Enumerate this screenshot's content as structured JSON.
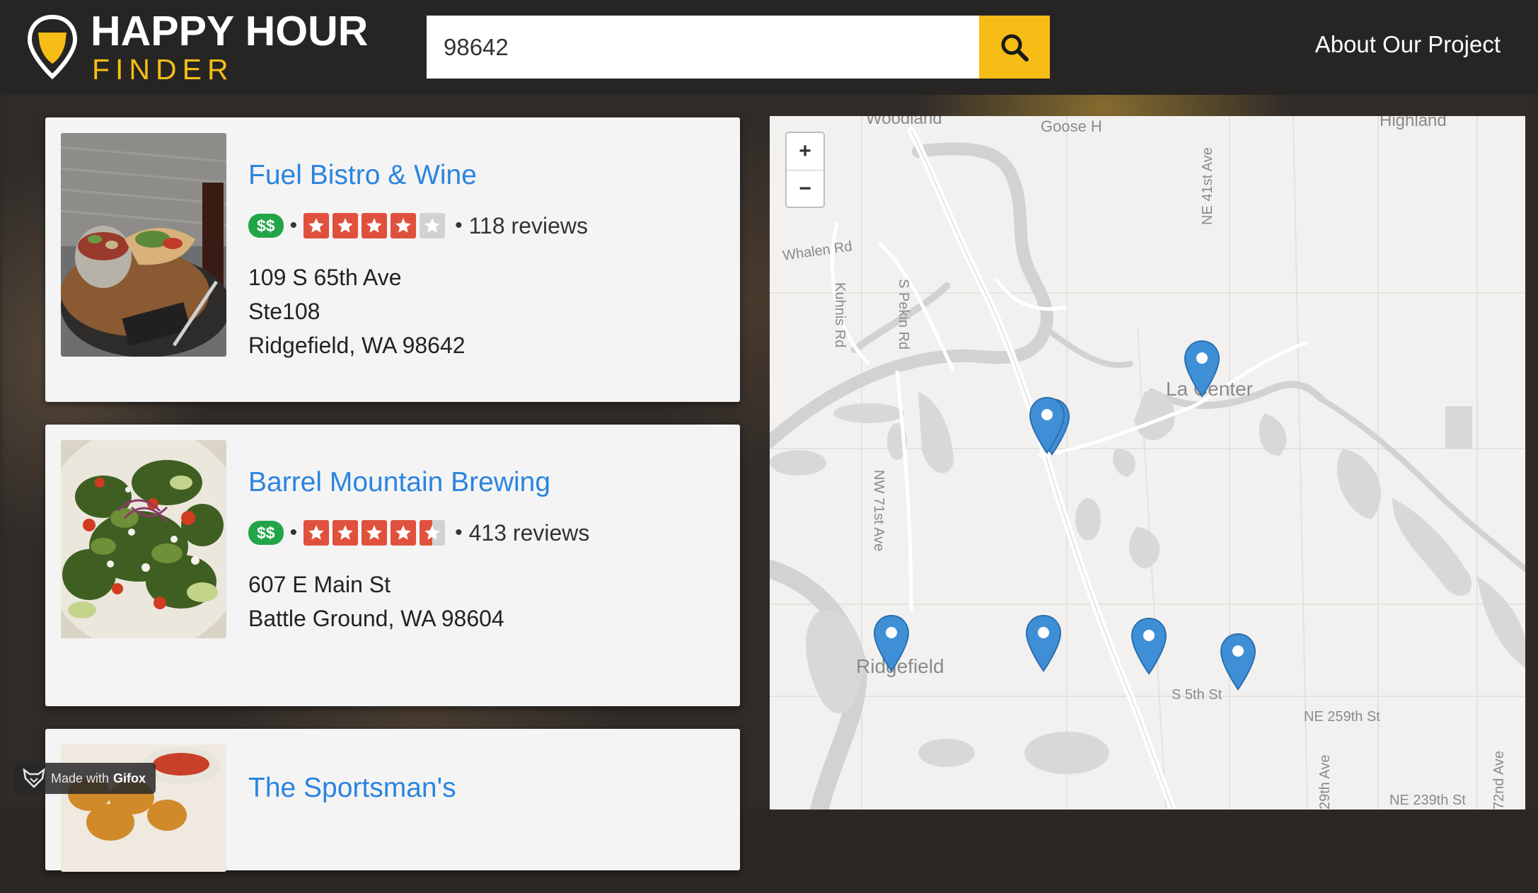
{
  "header": {
    "logo_title": "HAPPY HOUR",
    "logo_subtitle": "FINDER",
    "search_value": "98642",
    "search_icon": "search-icon",
    "about_label": "About Our Project"
  },
  "results": [
    {
      "name": "Fuel Bistro & Wine",
      "price": "$$",
      "rating": 4,
      "reviews": "118 reviews",
      "address_lines": [
        "109 S 65th Ave",
        "Ste108",
        "Ridgefield, WA 98642"
      ]
    },
    {
      "name": "Barrel Mountain Brewing",
      "price": "$$",
      "rating": 4.5,
      "reviews": "413 reviews",
      "address_lines": [
        "607 E Main St",
        "Battle Ground, WA 98604"
      ]
    },
    {
      "name": "The Sportsman's",
      "price": "",
      "rating": null,
      "reviews": "",
      "address_lines": []
    }
  ],
  "map": {
    "zoom_in": "+",
    "zoom_out": "−",
    "labels": {
      "goose": "Goose H",
      "highland": "Highland",
      "woodland": "Woodland",
      "whalen": "Whalen Rd",
      "pekin": "S Pekin Rd",
      "kuhnis": "Kuhnis Rd",
      "ne41": "NE 41st Ave",
      "lacenter": "La Center",
      "nw71": "NW 71st Ave",
      "ridgefield": "Ridgefield",
      "s5th": "S 5th St",
      "ne259": "NE 259th St",
      "ne239": "NE 239th St",
      "ave29": "29th Ave",
      "ave72": "72nd Ave"
    }
  },
  "badge": {
    "made_with": "Made with",
    "brand": "Gifox"
  },
  "colors": {
    "accent_yellow": "#f6bd16",
    "link_blue": "#2a84e0",
    "price_green": "#22a547",
    "star_red": "#e0513d",
    "marker_blue": "#3f8fd6"
  }
}
